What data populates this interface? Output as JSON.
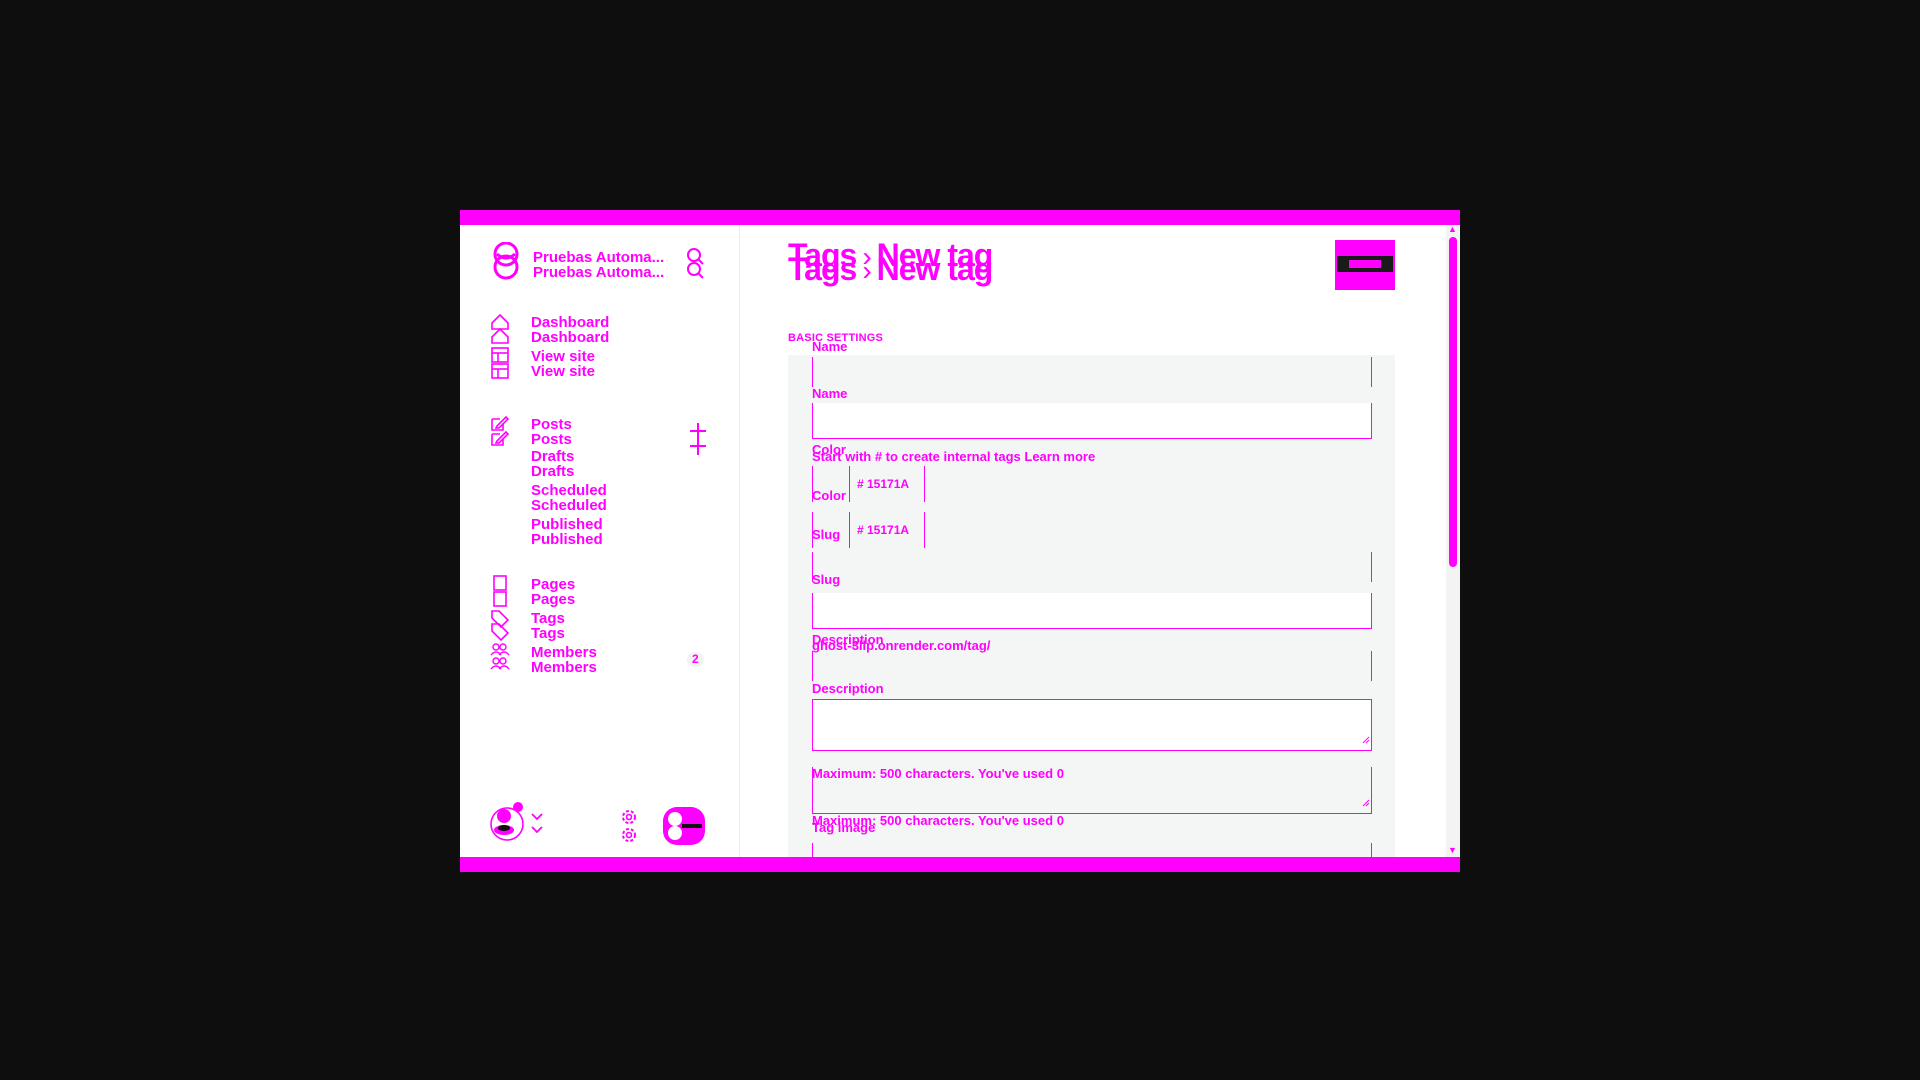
{
  "sidebar": {
    "site_title": "Pruebas Automa...",
    "nav": {
      "dashboard": "Dashboard",
      "view_site": "View site",
      "posts": "Posts",
      "drafts": "Drafts",
      "scheduled": "Scheduled",
      "published": "Published",
      "pages": "Pages",
      "tags": "Tags",
      "members": "Members",
      "members_count": "2"
    }
  },
  "header": {
    "breadcrumb_parent": "Tags",
    "breadcrumb_separator": "›",
    "breadcrumb_current": "New tag"
  },
  "form": {
    "section_label": "BASIC SETTINGS",
    "name_label": "Name",
    "name_hint": "Start with # to create internal tags Learn more",
    "color_label": "Color",
    "color_hex": "# 15171A",
    "slug_label": "Slug",
    "slug_hint": "ghost-3llp.onrender.com/tag/",
    "description_label": "Description",
    "description_hint_prefix": "Maximum: ",
    "description_max": "500",
    "description_hint_mid": " characters. You've used ",
    "description_used": "0",
    "tag_image_label": "Tag image"
  },
  "colors": {
    "accent": "#ff00ff",
    "background": "#0e0e0f",
    "panel": "#f4f5f5"
  },
  "icons": [
    "ghost-logo-icon",
    "search-icon",
    "home-icon",
    "view-site-icon",
    "edit-icon",
    "plus-icon",
    "pages-icon",
    "tag-icon",
    "members-icon",
    "avatar",
    "chevron-down-icon",
    "gear-icon",
    "moon-toggle-icon",
    "resize-handle-icon"
  ]
}
